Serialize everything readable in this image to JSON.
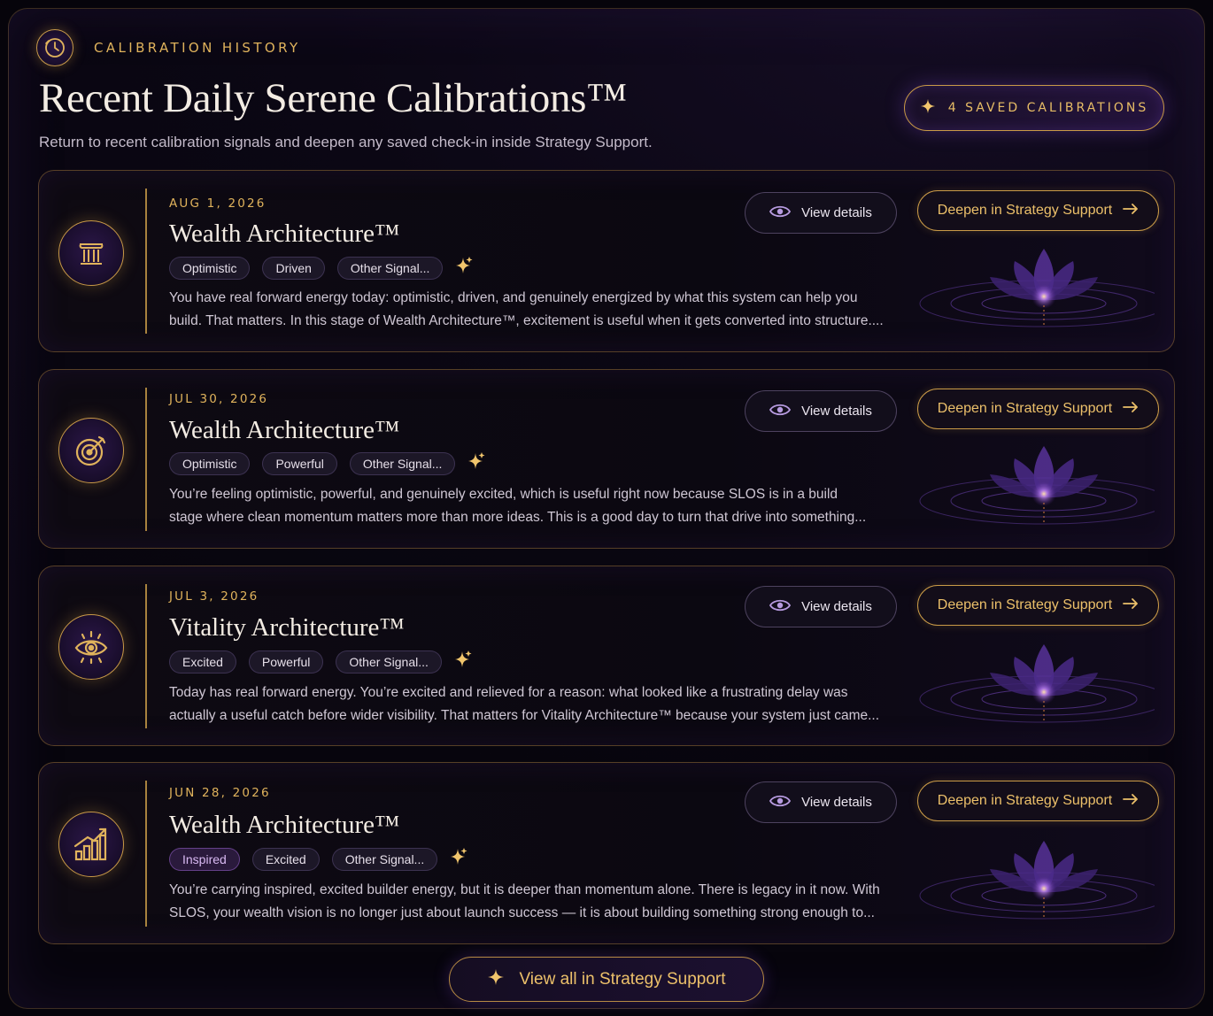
{
  "header": {
    "eyebrow": "CALIBRATION HISTORY",
    "title": "Recent Daily Serene Calibrations™",
    "subtitle": "Return to recent calibration signals and deepen any saved check-in inside Strategy Support.",
    "saved_badge": "4 SAVED CALIBRATIONS",
    "eyebrow_icon": "clock-icon"
  },
  "colors": {
    "accent_gold": "#e0b35c",
    "accent_purple": "#8a4fd8",
    "background": "#07050d"
  },
  "cards": [
    {
      "date": "AUG 1, 2026",
      "title": "Wealth Architecture™",
      "icon": "pillar-icon",
      "tags": [
        "Optimistic",
        "Driven",
        "Other Signal..."
      ],
      "desc1": "You have real forward energy today: optimistic, driven, and genuinely energized by what this system can help you",
      "desc2": "build. That matters. In this stage of Wealth Architecture™, excitement is useful when it gets converted into structure....",
      "view_label": "View details",
      "deepen_label": "Deepen in Strategy Support"
    },
    {
      "date": "JUL 30, 2026",
      "title": "Wealth Architecture™",
      "icon": "target-icon",
      "tags": [
        "Optimistic",
        "Powerful",
        "Other Signal..."
      ],
      "desc1": "You’re feeling optimistic, powerful, and genuinely excited, which is useful right now because SLOS is in a build",
      "desc2": "stage where clean momentum matters more than more ideas. This is a good day to turn that drive into something...",
      "view_label": "View details",
      "deepen_label": "Deepen in Strategy Support"
    },
    {
      "date": "JUL 3, 2026",
      "title": "Vitality Architecture™",
      "icon": "eye-icon",
      "tags": [
        "Excited",
        "Powerful",
        "Other Signal..."
      ],
      "desc1": "Today has real forward energy. You’re excited and relieved for a reason: what looked like a frustrating delay was",
      "desc2": "actually a useful catch before wider visibility. That matters for Vitality Architecture™ because your system just came...",
      "view_label": "View details",
      "deepen_label": "Deepen in Strategy Support"
    },
    {
      "date": "JUN 28, 2026",
      "title": "Wealth Architecture™",
      "icon": "growth-chart-icon",
      "tags": [
        "Inspired",
        "Excited",
        "Other Signal..."
      ],
      "desc1": "You’re carrying inspired, excited builder energy, but it is deeper than momentum alone. There is legacy in it now. With",
      "desc2": "SLOS, your wealth vision is no longer just about launch success — it is about building something strong enough to...",
      "view_label": "View details",
      "deepen_label": "Deepen in Strategy Support"
    }
  ],
  "footer": {
    "view_all_label": "View all in Strategy Support"
  }
}
